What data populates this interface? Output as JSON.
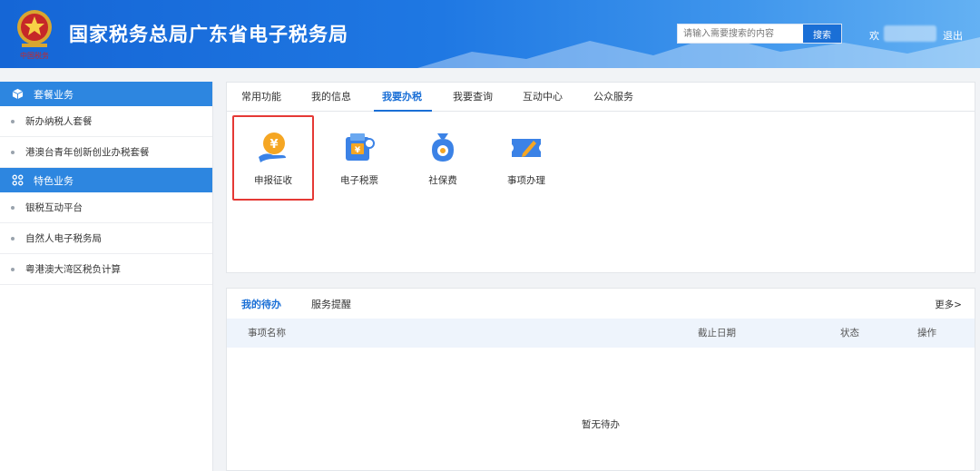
{
  "header": {
    "title": "国家税务总局广东省电子税务局",
    "search_placeholder": "请输入需要搜索的内容",
    "search_label": "搜索",
    "welcome": "欢",
    "logout": "退出"
  },
  "sidebar": {
    "sections": [
      {
        "title": "套餐业务",
        "icon": "cube-icon",
        "items": [
          "新办纳税人套餐",
          "港澳台青年创新创业办税套餐"
        ]
      },
      {
        "title": "特色业务",
        "icon": "grid-icon",
        "items": [
          "银税互动平台",
          "自然人电子税务局",
          "粤港澳大湾区税负计算"
        ]
      }
    ]
  },
  "main": {
    "tabs": [
      "常用功能",
      "我的信息",
      "我要办税",
      "我要查询",
      "互动中心",
      "公众服务"
    ],
    "active_tab": "我要办税",
    "functions": [
      {
        "label": "申报征收",
        "icon": "declare-tax-icon",
        "highlighted": true
      },
      {
        "label": "电子税票",
        "icon": "e-tax-ticket-icon"
      },
      {
        "label": "社保费",
        "icon": "social-security-icon"
      },
      {
        "label": "事项办理",
        "icon": "matter-handling-icon"
      }
    ]
  },
  "todo": {
    "tabs": [
      "我的待办",
      "服务提醒"
    ],
    "more": "更多>",
    "columns": [
      "事项名称",
      "截止日期",
      "状态",
      "操作"
    ],
    "empty": "暂无待办"
  },
  "colors": {
    "header_blue": "#1f78e3",
    "accent": "#1a6fd6",
    "sidebar_cat": "#2d86e0",
    "highlight": "#e53935",
    "orange": "#f5a623"
  }
}
